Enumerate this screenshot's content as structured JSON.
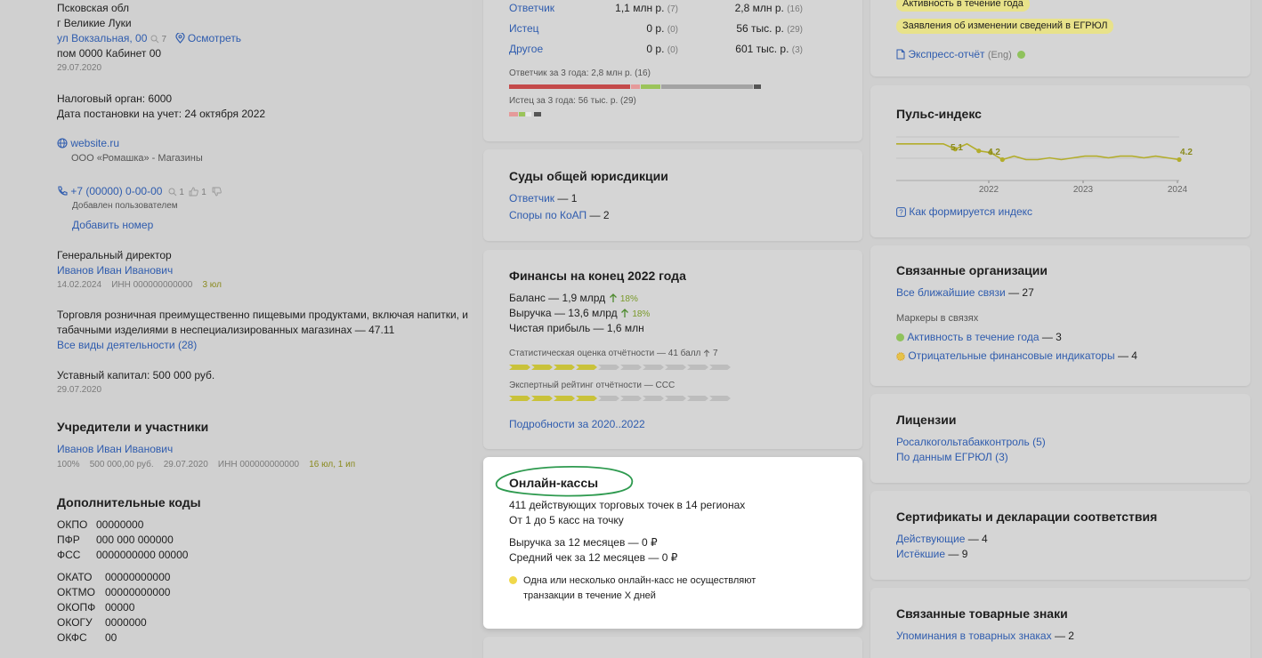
{
  "left": {
    "region": "Псковская обл",
    "city": "г Великие Луки",
    "street": "ул Вокзальная, 00",
    "street_views": "7",
    "map_link": "Осмотреть",
    "room": "пом 0000 Кабинет 00",
    "address_date": "29.07.2020",
    "tax_authority": "Налоговый орган: 6000",
    "registration": "Дата постановки на учет: 24 октября 2022",
    "website": "website.ru",
    "website_desc": "ООО «Ромашка» - Магазины",
    "phone": "+7 (00000) 0-00-00",
    "phone_views": "1",
    "phone_likes": "1",
    "phone_added": "Добавлен пользователем",
    "add_phone": "Добавить номер",
    "director_role": "Генеральный директор",
    "director_name": "Иванов Иван Иванович",
    "director_date": "14.02.2024",
    "director_inn": "ИНН 000000000000",
    "director_badge": "3 юл",
    "activity_line1": "Торговля розничная преимущественно пищевыми продуктами, включая напитки, и",
    "activity_line2": "табачными изделиями в неспециализированных магазинах — 47.11",
    "activity_all": "Все виды деятельности (28)",
    "capital": "Уставный капитал: 500 000 руб.",
    "capital_date": "29.07.2020",
    "founders_title": "Учредители и участники",
    "founder_name": "Иванов Иван Иванович",
    "founder_share": "100%",
    "founder_sum": "500 000,00 руб.",
    "founder_date": "29.07.2020",
    "founder_inn": "ИНН 000000000000",
    "founder_badge": "16 юл, 1 ип",
    "codes_title": "Дополнительные коды",
    "codes_a": [
      {
        "k": "ОКПО",
        "v": "00000000"
      },
      {
        "k": "ПФР",
        "v": "000 000 000000"
      },
      {
        "k": "ФСС",
        "v": "0000000000 00000"
      }
    ],
    "codes_b": [
      {
        "k": "ОКАТО",
        "v": "00000000000"
      },
      {
        "k": "ОКТМО",
        "v": "00000000000"
      },
      {
        "k": "ОКОПФ",
        "v": "00000"
      },
      {
        "k": "ОКОГУ",
        "v": "0000000"
      },
      {
        "k": "ОКФС",
        "v": "00"
      }
    ]
  },
  "arbitration": {
    "rows": [
      {
        "label": "Ответчик",
        "sum": "1,1 млн р.",
        "cnt": "(7)",
        "sum3": "2,8 млн р.",
        "cnt3": "(16)"
      },
      {
        "label": "Истец",
        "sum": "0 р.",
        "cnt": "(0)",
        "sum3": "56 тыс. р.",
        "cnt3": "(29)"
      },
      {
        "label": "Другое",
        "sum": "0 р.",
        "cnt": "(0)",
        "sum3": "601 тыс. р.",
        "cnt3": "(3)"
      }
    ],
    "defendant_caption": "Ответчик за 3 года: 2,8 млн р. (16)",
    "plaintiff_caption": "Истец за 3 года: 56 тыс. р. (29)"
  },
  "courts": {
    "title": "Суды общей юрисдикции",
    "item1_link": "Ответчик",
    "item1_val": "— 1",
    "item2_link": "Споры по КоАП",
    "item2_val": "— 2"
  },
  "finance": {
    "title": "Финансы на конец 2022 года",
    "balance": "Баланс — 1,9 млрд",
    "balance_pct": "18%",
    "revenue": "Выручка — 13,6 млрд",
    "revenue_pct": "18%",
    "profit": "Чистая прибыль — 1,6 млн",
    "stat_caption": "Статистическая оценка отчётности — 41 балл",
    "stat_delta": "7",
    "stat_level": 0.4,
    "expert_caption": "Экспертный рейтинг отчётности — CCC",
    "expert_level": 0.4,
    "details_link": "Подробности за 2020..2022"
  },
  "kassy": {
    "title": "Онлайн-кассы",
    "line1": "411 действующих торговых точек в 14 регионах",
    "line2": "От 1 до 5 касс на точку",
    "revenue": "Выручка за 12 месяцев — 0 ₽",
    "avg_check": "Средний чек за 12 месяцев — 0 ₽",
    "warn1": "Одна или несколько онлайн-касс не осуществляют",
    "warn2": "транзакции в течение X дней"
  },
  "right_top": {
    "tag1": "Активность в течение года",
    "tag2": "Заявления об изменении сведений в ЕГРЮЛ",
    "express": "Экспресс-отчёт",
    "express_lang": "(Eng)"
  },
  "pulse": {
    "title": "Пульс-индекс",
    "label_a": "5.1",
    "label_b": "4.2",
    "label_end": "4.2",
    "years": [
      "2022",
      "2023",
      "2024"
    ],
    "how_link": "Как формируется индекс"
  },
  "chart_data": {
    "type": "line",
    "title": "Пульс-индекс",
    "x_ticks": [
      "2022",
      "2023",
      "2024"
    ],
    "series": [
      {
        "values": [
          5.1,
          5.1,
          5.1,
          5.1,
          5.1,
          4.8,
          5.1,
          4.7,
          4.6,
          4.2,
          4.4,
          4.2,
          4.2,
          4.3,
          4.2,
          4.3,
          4.4,
          4.4,
          4.3,
          4.4,
          4.4,
          4.3,
          4.4,
          4.3,
          4.2
        ]
      }
    ],
    "annotations": [
      "5.1",
      "4.2",
      "4.2"
    ],
    "grid": true
  },
  "related": {
    "title": "Связанные организации",
    "all_link": "Все ближайшие связи",
    "all_val": "— 27",
    "markers": "Маркеры в связях",
    "m1_link": "Активность в течение года",
    "m1_val": "— 3",
    "m2_link": "Отрицательные финансовые индикаторы",
    "m2_val": "— 4"
  },
  "licenses": {
    "title": "Лицензии",
    "l1": "Росалкогольтабакконтроль (5)",
    "l2": "По данным ЕГРЮЛ (3)"
  },
  "certs": {
    "title": "Сертификаты и декларации соответствия",
    "c1_link": "Действующие",
    "c1_val": "— 4",
    "c2_link": "Истёкшие",
    "c2_val": "— 9"
  },
  "trademarks": {
    "title": "Связанные товарные знаки",
    "t1_link": "Упоминания в товарных знаках",
    "t1_val": "— 2"
  },
  "colors": {
    "link": "#2f5cae",
    "olive": "#b3ad2b",
    "red_bar": "#c44a4a",
    "green_bar": "#9bc45a",
    "highlight": "#2e9a4f"
  }
}
